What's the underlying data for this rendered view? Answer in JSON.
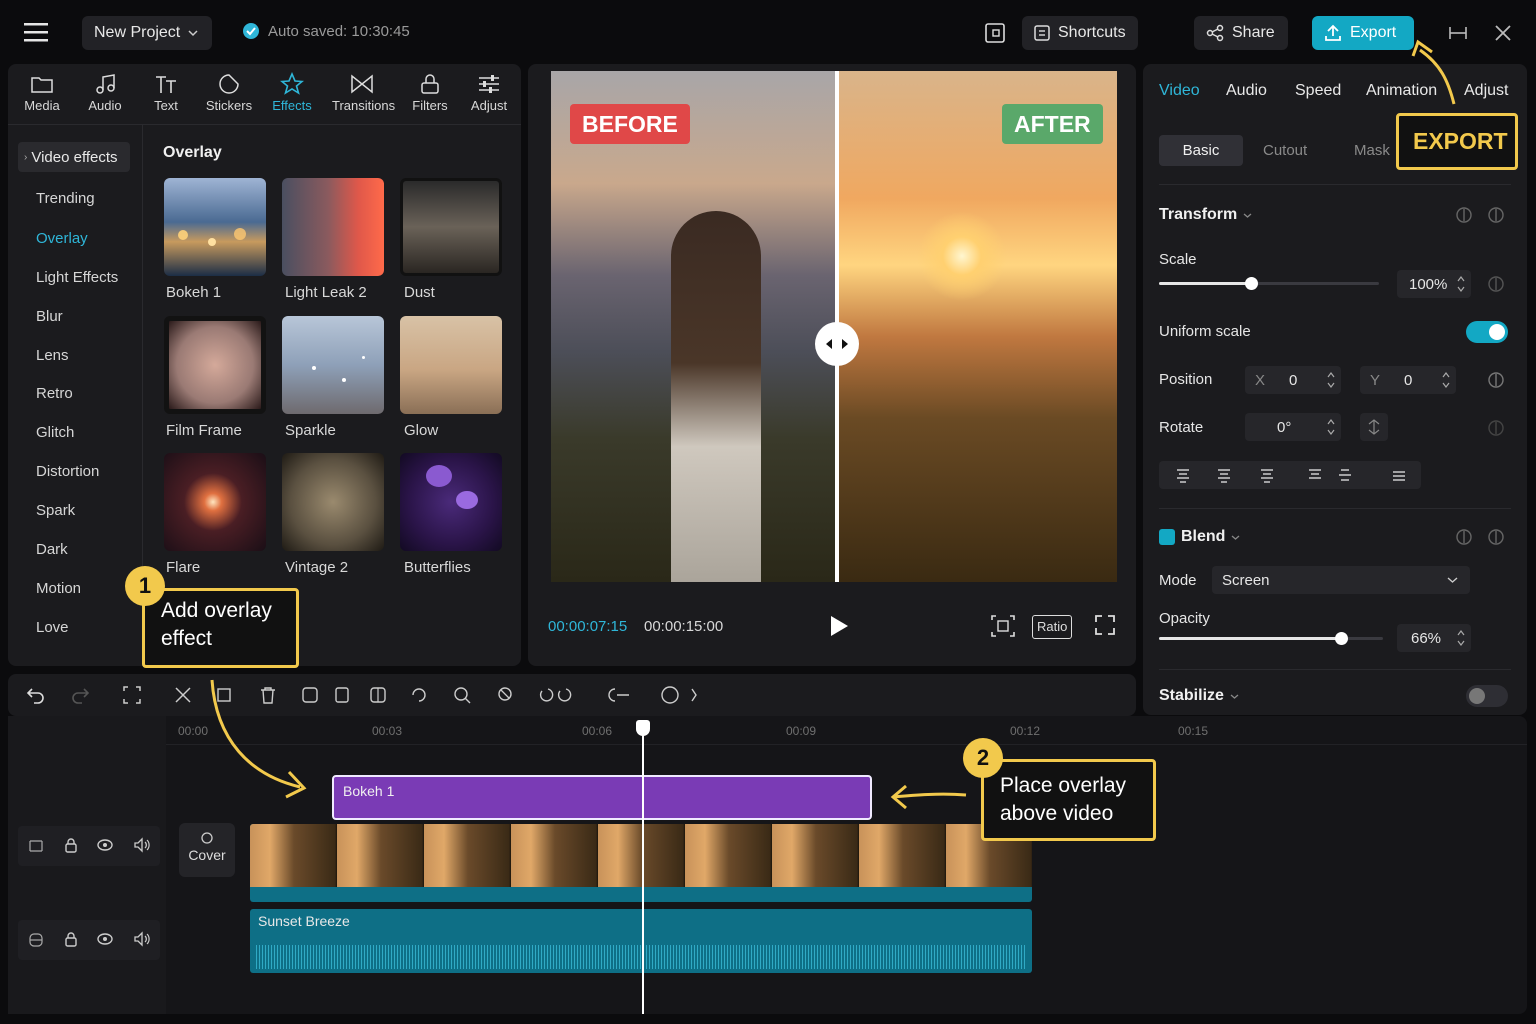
{
  "topbar": {
    "project_name": "New Project",
    "autosave": "Auto saved: 10:30:45",
    "shortcuts_label": "Shortcuts",
    "share_label": "Share",
    "export_label": "Export"
  },
  "tools": [
    {
      "label": "Media",
      "icon": "folder-icon"
    },
    {
      "label": "Audio",
      "icon": "music-note-icon"
    },
    {
      "label": "Text",
      "icon": "text-icon"
    },
    {
      "label": "Stickers",
      "icon": "sticker-icon"
    },
    {
      "label": "Effects",
      "icon": "star-icon"
    },
    {
      "label": "Transitions",
      "icon": "transition-icon"
    },
    {
      "label": "Filters",
      "icon": "filter-icon"
    },
    {
      "label": "Adjust",
      "icon": "sliders-icon"
    }
  ],
  "effects": {
    "section_header": "Video effects",
    "categories": [
      "Trending",
      "Overlay",
      "Light Effects",
      "Blur",
      "Lens",
      "Retro",
      "Glitch",
      "Distortion",
      "Spark",
      "Dark",
      "Motion",
      "Love"
    ],
    "active_category": "Overlay",
    "grid_title": "Overlay",
    "items": [
      "Bokeh 1",
      "Light Leak 2",
      "Dust",
      "Film Frame",
      "Sparkle",
      "Glow",
      "Flare",
      "Vintage 2",
      "Butterflies"
    ]
  },
  "preview": {
    "before_label": "BEFORE",
    "after_label": "AFTER",
    "current_time": "00:00:07:15",
    "total_time": "00:00:15:00",
    "ratio_label": "Ratio"
  },
  "inspector": {
    "tabs": [
      "Video",
      "Audio",
      "Speed",
      "Animation",
      "Adjust"
    ],
    "subtabs": [
      "Basic",
      "Cutout",
      "Mask"
    ],
    "transform_label": "Transform",
    "scale_label": "Scale",
    "scale_value": "100%",
    "scale_fraction": 0.5,
    "uniform_scale_label": "Uniform scale",
    "position_label": "Position",
    "x_label": "X",
    "x_value": "0",
    "y_label": "Y",
    "y_value": "0",
    "rotate_label": "Rotate",
    "rotate_value": "0°",
    "blend_label": "Blend",
    "mode_label": "Mode",
    "mode_value": "Screen",
    "opacity_label": "Opacity",
    "opacity_value": "66%",
    "opacity_fraction": 0.66,
    "stabilize_label": "Stabilize"
  },
  "timeline": {
    "ticks": [
      "00:00",
      "00:03",
      "00:06",
      "00:09",
      "00:12",
      "00:15"
    ],
    "overlay_clip": "Bokeh 1",
    "cover_label": "Cover",
    "audio_clip": "Sunset Breeze"
  },
  "annotations": {
    "export_callout": "EXPORT",
    "step1_number": "1",
    "step1_text_line1": "Add overlay",
    "step1_text_line2": "effect",
    "step2_number": "2",
    "step2_text_line1": "Place overlay",
    "step2_text_line2": "above video"
  },
  "colors": {
    "accent": "#2fb6d8",
    "export_button": "#13a8c4",
    "before_badge": "#e04848",
    "after_badge": "#5aa86a",
    "overlay_clip": "#7a3bb5",
    "audio_clip": "#0e6f86",
    "annotation": "#f2c94c"
  }
}
